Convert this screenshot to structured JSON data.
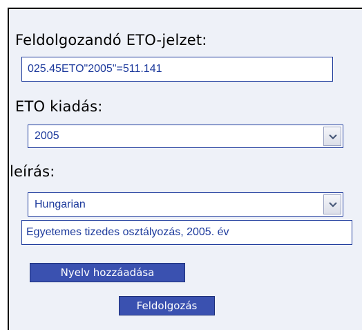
{
  "form": {
    "eto_label": "Feldolgozandó ETO-jelzet:",
    "eto_value": "025.45ETO\"2005\"=511.141",
    "edition_label": "ETO kiadás:",
    "edition_selected": "2005",
    "description_label": "leírás:",
    "language_selected": "Hungarian",
    "description_value": "Egyetemes tizedes osztályozás, 2005. év",
    "add_language_button": "Nyelv hozzáadása",
    "process_button": "Feldolgozás"
  },
  "icons": {
    "dropdown": "chevron-down-icon"
  }
}
